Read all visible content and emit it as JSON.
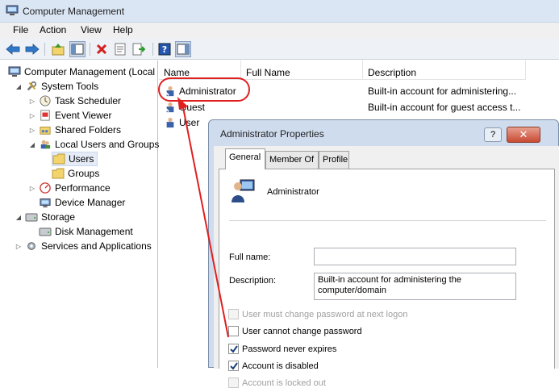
{
  "window": {
    "title": "Computer Management"
  },
  "menu": [
    "File",
    "Action",
    "View",
    "Help"
  ],
  "toolbar": {
    "buttons": [
      "back-arrow",
      "forward-arrow",
      "up-folder",
      "show-hide-console-tree",
      "delete",
      "properties",
      "export-list",
      "help",
      "show-hide-action-pane"
    ]
  },
  "tree": {
    "root": "Computer Management (Local",
    "system_tools": "System Tools",
    "task_scheduler": "Task Scheduler",
    "event_viewer": "Event Viewer",
    "shared_folders": "Shared Folders",
    "local_users": "Local Users and Groups",
    "users": "Users",
    "groups": "Groups",
    "performance": "Performance",
    "device_manager": "Device Manager",
    "storage": "Storage",
    "disk_management": "Disk Management",
    "services": "Services and Applications"
  },
  "list": {
    "columns": {
      "name": "Name",
      "full_name": "Full Name",
      "description": "Description"
    },
    "rows": [
      {
        "name": "Administrator",
        "full_name": "",
        "description": "Built-in account for administering..."
      },
      {
        "name": "Guest",
        "full_name": "",
        "description": "Built-in account for guest access t..."
      },
      {
        "name": "User",
        "full_name": "",
        "description": ""
      }
    ]
  },
  "dialog": {
    "title": "Administrator Properties",
    "help_label": "?",
    "close_label": "✕",
    "tabs": [
      "General",
      "Member Of",
      "Profile"
    ],
    "account_name": "Administrator",
    "full_name_label": "Full name:",
    "full_name_value": "",
    "description_label": "Description:",
    "description_value": "Built-in account for administering the computer/domain",
    "checkboxes": [
      {
        "label": "User must change password at next logon",
        "checked": false,
        "enabled": false
      },
      {
        "label": "User cannot change password",
        "checked": false,
        "enabled": true
      },
      {
        "label": "Password never expires",
        "checked": true,
        "enabled": true
      },
      {
        "label": "Account is disabled",
        "checked": true,
        "enabled": true
      },
      {
        "label": "Account is locked out",
        "checked": false,
        "enabled": false
      }
    ]
  },
  "colors": {
    "annotation": "#e02020",
    "accent": "#dbe6f4"
  }
}
